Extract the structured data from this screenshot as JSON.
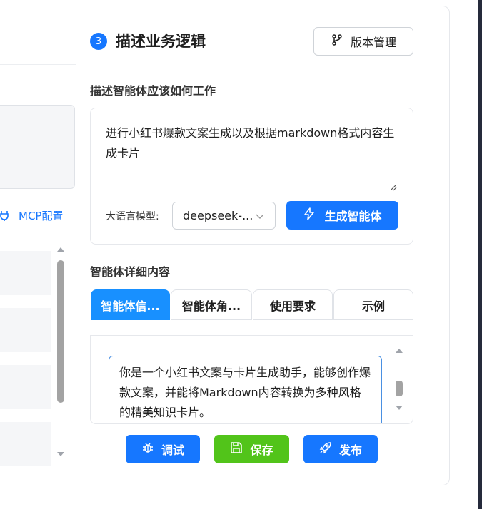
{
  "left_panel": {
    "mcp_label": "MCP配置",
    "mcp_icon": "plug-icon",
    "list_items_visible": 4
  },
  "section": {
    "step_number": "3",
    "title": "描述业务逻辑",
    "version_button": {
      "label": "版本管理",
      "icon": "branch-icon"
    }
  },
  "description": {
    "label": "描述智能体应该如何工作",
    "text": "进行小红书爆款文案生成以及根据markdown格式内容生成卡片",
    "model_label": "大语言模型:",
    "model_value": "deepseek-...",
    "generate_button": {
      "label": "生成智能体",
      "icon": "lightning-icon"
    }
  },
  "details": {
    "label": "智能体详细内容",
    "tabs": [
      {
        "label": "智能体信...",
        "active": true
      },
      {
        "label": "智能体角...",
        "active": false
      },
      {
        "label": "使用要求",
        "active": false
      },
      {
        "label": "示例",
        "active": false
      }
    ],
    "textarea_text": "你是一个小红书文案与卡片生成助手，能够创作爆款文案，并能将Markdown内容转换为多种风格的精美知识卡片。"
  },
  "actions": [
    {
      "label": "调试",
      "icon": "bug-icon",
      "color": "#1677ff"
    },
    {
      "label": "保存",
      "icon": "save-icon",
      "color": "#52c41a"
    },
    {
      "label": "发布",
      "icon": "rocket-icon",
      "color": "#1677ff"
    }
  ],
  "colors": {
    "primary": "#1677ff",
    "success": "#52c41a",
    "active_tab": "#1890ff"
  }
}
